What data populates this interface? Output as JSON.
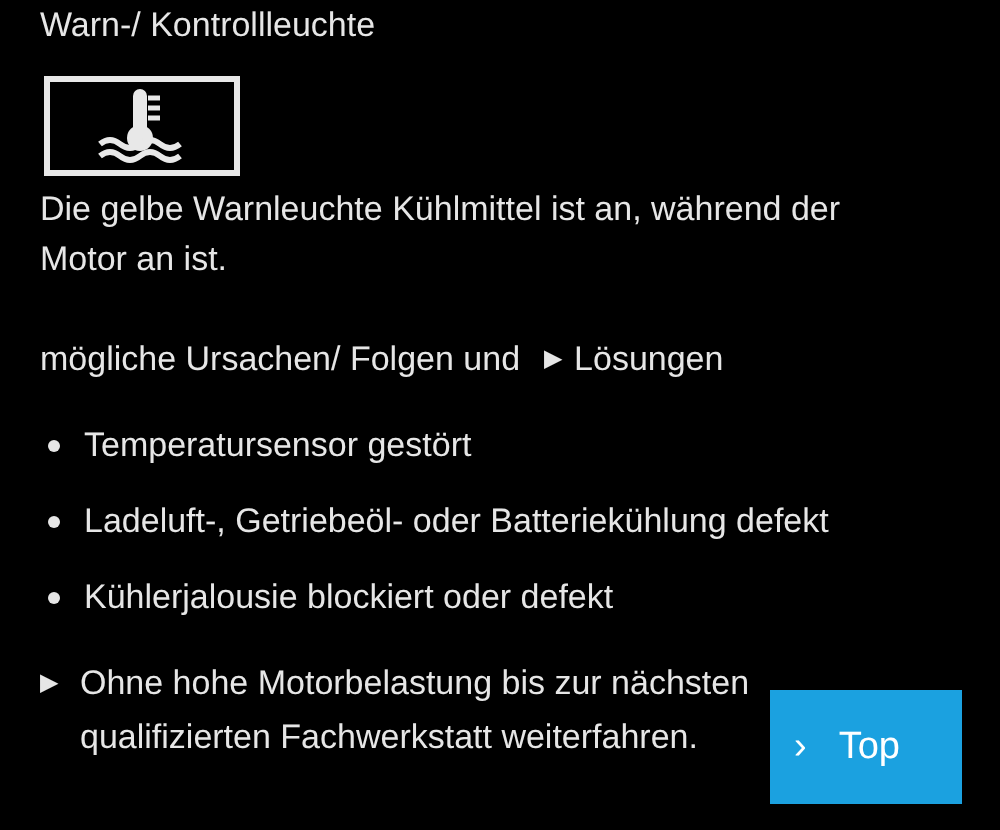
{
  "title": "Warn-/ Kontrollleuchte",
  "warning_icon": {
    "kind": "coolant-temperature"
  },
  "description": "Die gelbe Warnleuchte Kühlmittel ist an, während der Motor an ist.",
  "causes_heading": {
    "text": "mögliche Ursachen/ Folgen und",
    "marker": "▶",
    "link": "Lösungen"
  },
  "causes": [
    {
      "text": "Temperatursensor gestört"
    },
    {
      "text": "Ladeluft-, Getriebeöl- oder Batteriekühlung defekt"
    },
    {
      "text": "Kühlerjalousie blockiert oder defekt"
    }
  ],
  "solutions": [
    {
      "marker": "▶",
      "text": "Ohne hohe Motorbelastung bis zur nächsten qualifizierten Fachwerkstatt weiterfahren."
    }
  ],
  "top_button": {
    "icon": "›",
    "label": "Top"
  }
}
